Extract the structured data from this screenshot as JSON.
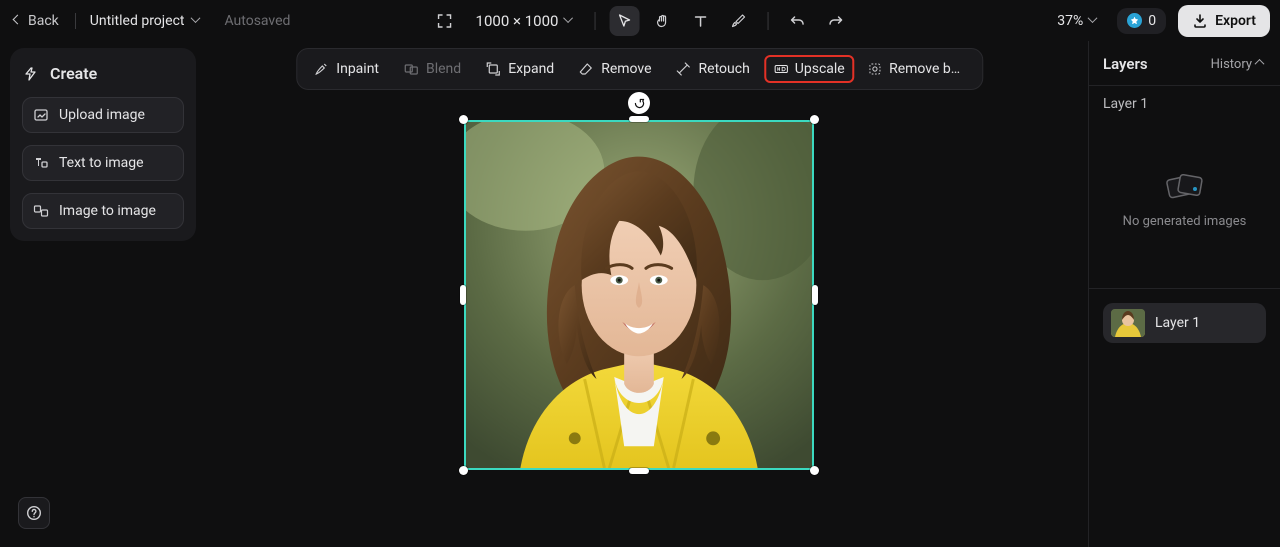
{
  "topbar": {
    "back_label": "Back",
    "project_title": "Untitled project",
    "autosaved_label": "Autosaved",
    "canvas_size": "1000 × 1000",
    "zoom": "37%",
    "tokens": "0",
    "export_label": "Export"
  },
  "left_panel": {
    "create_label": "Create",
    "upload_image": "Upload image",
    "text_to_image": "Text to image",
    "image_to_image": "Image to image"
  },
  "action_toolbar": {
    "inpaint": "Inpaint",
    "blend": "Blend",
    "expand": "Expand",
    "remove": "Remove",
    "retouch": "Retouch",
    "upscale": "Upscale",
    "remove_background": "Remove back…"
  },
  "right_panel": {
    "layers_title": "Layers",
    "history_label": "History",
    "selected_layer": "Layer 1",
    "no_generated_images": "No generated images",
    "layer_row_label": "Layer 1"
  },
  "canvas": {
    "image_alt": "Portrait photo of smiling woman with curly brown hair wearing a yellow denim jacket over a white top, blurred green outdoor background"
  }
}
